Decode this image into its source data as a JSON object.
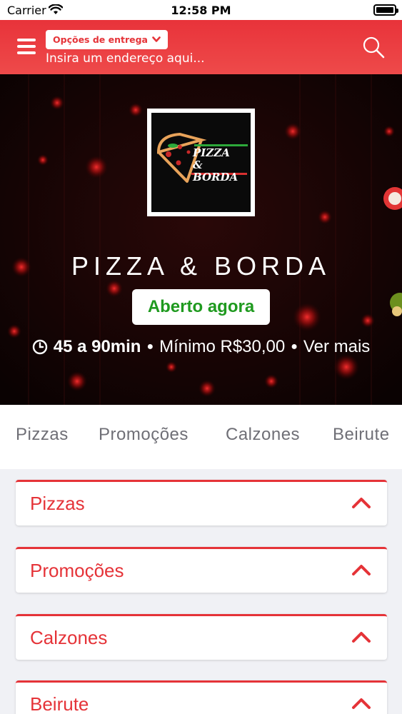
{
  "status_bar": {
    "carrier": "Carrier",
    "time": "12:58 PM"
  },
  "header": {
    "delivery_options_label": "Opções de entrega",
    "address_placeholder": "Insira um endereço aqui..."
  },
  "hero": {
    "logo_text_line1": "PIZZA",
    "logo_text_line2": "& BORDA",
    "restaurant_name": "PIZZA & BORDA",
    "status": "Aberto agora",
    "delivery_time": "45 a 90min",
    "minimum": "Mínimo R$30,00",
    "see_more": "Ver mais",
    "separator": "●"
  },
  "tabs": [
    "Pizzas",
    "Promoções",
    "Calzones",
    "Beirute"
  ],
  "sections": [
    "Pizzas",
    "Promoções",
    "Calzones",
    "Beirute"
  ],
  "colors": {
    "brand_red": "#e53338",
    "open_green": "#1f9a1f",
    "tab_gray": "#6f6f76"
  },
  "icons": [
    "menu-icon",
    "chevron-down-icon",
    "search-icon",
    "clock-icon",
    "chevron-up-icon",
    "wifi-icon",
    "battery-icon"
  ]
}
